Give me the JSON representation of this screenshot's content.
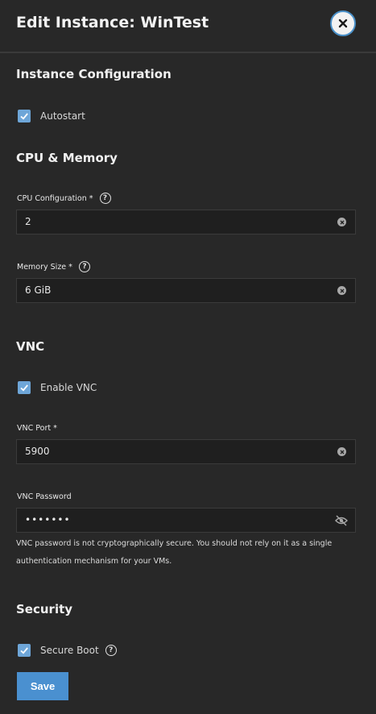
{
  "header": {
    "title": "Edit Instance: WinTest",
    "close_icon": "close-icon"
  },
  "instance_config": {
    "title": "Instance Configuration",
    "autostart": {
      "label": "Autostart",
      "checked": true
    }
  },
  "cpu_memory": {
    "title": "CPU & Memory",
    "cpu": {
      "label": "CPU Configuration *",
      "value": "2"
    },
    "memory": {
      "label": "Memory Size *",
      "value": "6 GiB"
    }
  },
  "vnc": {
    "title": "VNC",
    "enable": {
      "label": "Enable VNC",
      "checked": true
    },
    "port": {
      "label": "VNC Port *",
      "value": "5900"
    },
    "password": {
      "label": "VNC Password",
      "value": "•••••••",
      "hint": "VNC password is not cryptographically secure. You should not rely on it as a single authentication mechanism for your VMs."
    }
  },
  "security": {
    "title": "Security",
    "secure_boot": {
      "label": "Secure Boot",
      "checked": true
    }
  },
  "footer": {
    "save_label": "Save"
  },
  "colors": {
    "accent": "#4a90d0",
    "checkbox": "#6ea6d8",
    "background": "#282828",
    "input_bg": "#1f1f1f"
  }
}
